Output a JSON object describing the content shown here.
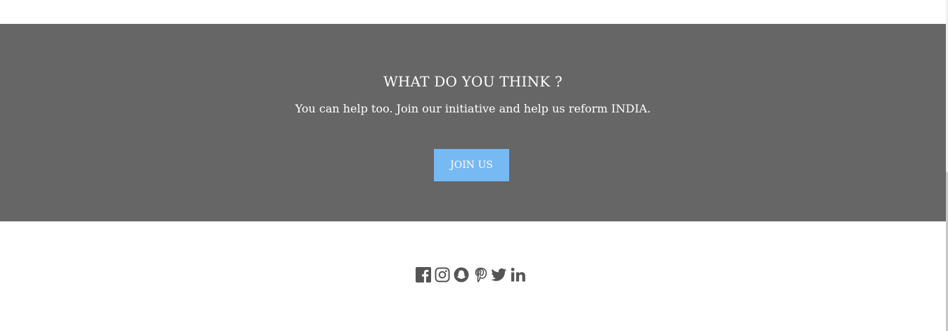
{
  "cta": {
    "title": "WHAT DO YOU THINK ?",
    "subtitle": "You can help too. Join our initiative and help us reform INDIA.",
    "button_label": "JOIN US",
    "band_color": "#666666",
    "button_color": "#77b9f3"
  },
  "social": {
    "icons": [
      "facebook-icon",
      "instagram-icon",
      "snapchat-icon",
      "pinterest-icon",
      "twitter-icon",
      "linkedin-icon"
    ],
    "icon_color": "#555555"
  }
}
